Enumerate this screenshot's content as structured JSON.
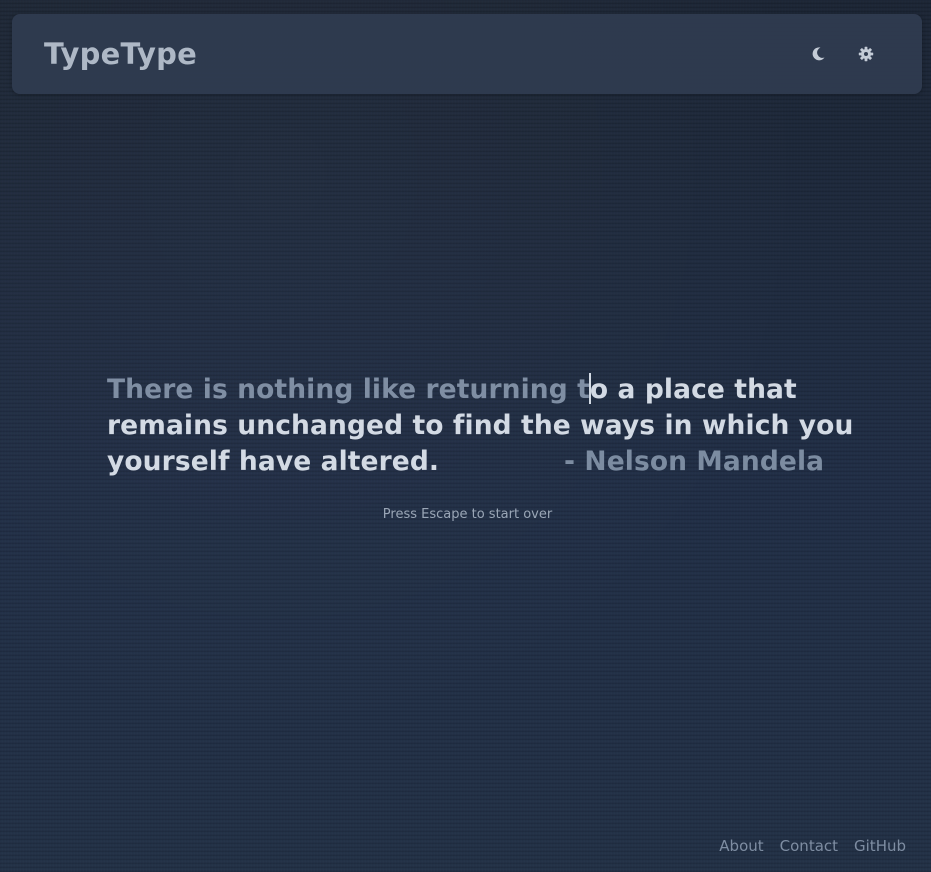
{
  "app": {
    "title": "TypeType"
  },
  "header": {
    "theme_toggle_icon": "moon-icon",
    "settings_icon": "gear-icon"
  },
  "quote": {
    "line1_typed": "There is nothing like returning t",
    "line1_remaining": "o a place that",
    "line2": "remains unchanged to find the ways in which you",
    "line3": "yourself have altered.",
    "author": "- Nelson Mandela"
  },
  "hint": "Press Escape to start over",
  "footer": {
    "links": [
      "About",
      "Contact",
      "GitHub"
    ]
  },
  "colors": {
    "background": "#1f2a3b",
    "navbar": "#303c50",
    "typed_text": "#7f8ea3",
    "untyped_text": "#d3dae4",
    "brand": "#aeb8c6"
  }
}
